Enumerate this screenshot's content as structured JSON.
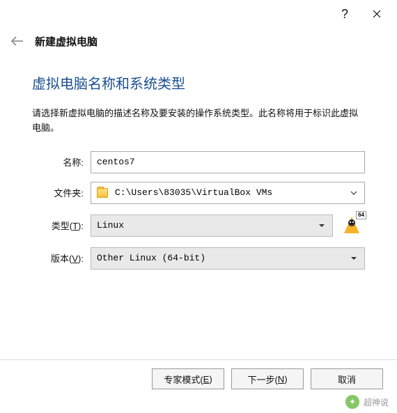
{
  "titlebar": {
    "help": "?",
    "close": "×"
  },
  "header": {
    "title": "新建虚拟电脑"
  },
  "page": {
    "heading": "虚拟电脑名称和系统类型",
    "description": "请选择新虚拟电脑的描述名称及要安装的操作系统类型。此名称将用于标识此虚拟电脑。"
  },
  "form": {
    "name_label": "名称:",
    "name_value": "centos7",
    "folder_label": "文件夹:",
    "folder_value": "C:\\Users\\83035\\VirtualBox VMs",
    "type_label_pre": "类型(",
    "type_label_u": "T",
    "type_label_post": "):",
    "type_value": "Linux",
    "version_label_pre": "版本(",
    "version_label_u": "V",
    "version_label_post": "):",
    "version_value": "Other Linux (64-bit)",
    "os_badge": "64"
  },
  "footer": {
    "expert_pre": "专家模式(",
    "expert_u": "E",
    "expert_post": ")",
    "next_pre": "下一步(",
    "next_u": "N",
    "next_post": ")",
    "cancel": "取消"
  },
  "watermark": {
    "text": "超神说"
  }
}
